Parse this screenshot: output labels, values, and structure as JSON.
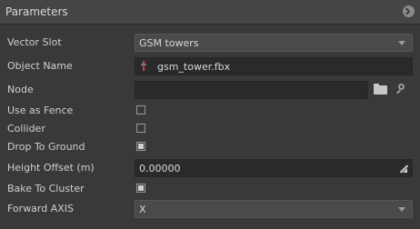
{
  "panel": {
    "title": "Parameters",
    "options_icon": "collapse-icon"
  },
  "fields": {
    "vector_slot": {
      "label": "Vector Slot",
      "value": "GSM towers"
    },
    "object_name": {
      "label": "Object Name",
      "value": "gsm_tower.fbx",
      "icon": "file-icon"
    },
    "node": {
      "label": "Node",
      "value": "",
      "browse_icon": "folder-icon",
      "search_icon": "search-icon"
    },
    "use_as_fence": {
      "label": "Use as Fence",
      "checked": false
    },
    "collider": {
      "label": "Collider",
      "checked": false
    },
    "drop_to_ground": {
      "label": "Drop To Ground",
      "checked": true
    },
    "height_offset": {
      "label": "Height Offset (m)",
      "value": "0.00000",
      "icon": "drag-adjust-icon"
    },
    "bake_to_cluster": {
      "label": "Bake To Cluster",
      "checked": true
    },
    "forward_axis": {
      "label": "Forward AXIS",
      "value": "X"
    }
  },
  "colors": {
    "background": "#393939",
    "header": "#454545",
    "field": "#2a2a2a",
    "combo": "#4a4a4a"
  }
}
